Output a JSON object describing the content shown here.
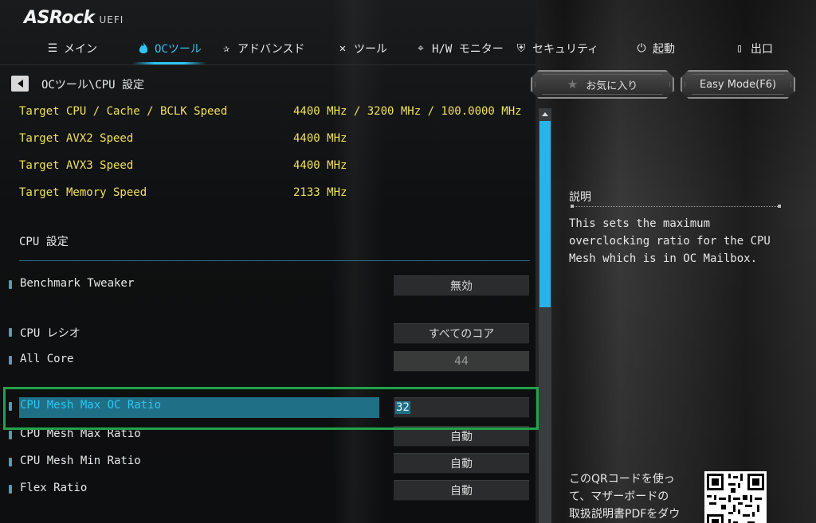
{
  "brand": {
    "name": "ASRock",
    "sub": "UEFI"
  },
  "nav": [
    {
      "label": "メイン",
      "icon": "list-icon"
    },
    {
      "label": "OCツール",
      "icon": "flame-icon",
      "active": true
    },
    {
      "label": "アドバンスド",
      "icon": "star-icon"
    },
    {
      "label": "ツール",
      "icon": "tools-icon"
    },
    {
      "label": "H/W モニター",
      "icon": "crosshair-icon"
    },
    {
      "label": "セキュリティ",
      "icon": "shield-icon"
    },
    {
      "label": "起動",
      "icon": "power-icon"
    },
    {
      "label": "出口",
      "icon": "exit-icon"
    }
  ],
  "breadcrumb": "OCツール\\CPU 設定",
  "targets": [
    {
      "label": "Target CPU / Cache / BCLK Speed",
      "value": "4400 MHz / 3200 MHz / 100.0000 MHz"
    },
    {
      "label": "Target AVX2 Speed",
      "value": "4400 MHz"
    },
    {
      "label": "Target AVX3 Speed",
      "value": "4400 MHz"
    },
    {
      "label": "Target Memory Speed",
      "value": "2133 MHz"
    }
  ],
  "section_title": "CPU 設定",
  "settings": [
    {
      "label": "Benchmark Tweaker",
      "value": "無効"
    },
    {
      "label": "CPU レシオ",
      "value": "すべてのコア"
    },
    {
      "label": "All Core",
      "value": "44"
    },
    {
      "label": "CPU Mesh Max OC Ratio",
      "value": "32"
    },
    {
      "label": "CPU Mesh Max Ratio",
      "value": "自動"
    },
    {
      "label": "CPU Mesh Min Ratio",
      "value": "自動"
    },
    {
      "label": "Flex Ratio",
      "value": "自動"
    }
  ],
  "right_panel": {
    "favorites_label": "お気に入り",
    "easy_mode_label": "Easy Mode(F6)",
    "description_title": "説明",
    "description_lines": [
      "This sets the maximum",
      "overclocking ratio for the CPU",
      "Mesh which is in OC Mailbox."
    ],
    "qr_lines": [
      "このQRコードを使っ",
      "て、マザーボードの",
      "取扱説明書PDFをダウ"
    ]
  },
  "colors": {
    "accent": "#2ec5f2",
    "target_text": "#f0e15a",
    "highlight": "#1f6f86",
    "focus_frame": "#22a24a"
  }
}
